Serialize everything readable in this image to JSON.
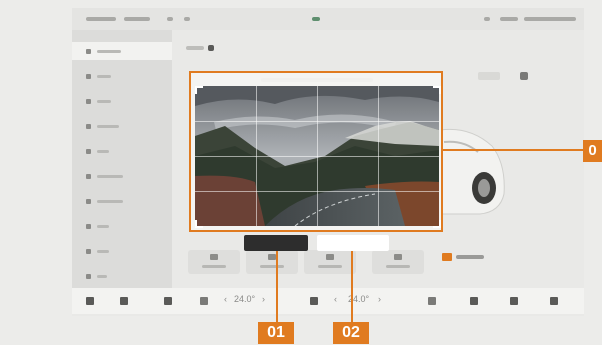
{
  "statusbar": {
    "items": [
      "",
      "",
      "",
      "",
      ""
    ]
  },
  "sidebar": {
    "items": [
      {
        "label": ""
      },
      {
        "label": ""
      },
      {
        "label": ""
      },
      {
        "label": ""
      },
      {
        "label": ""
      },
      {
        "label": ""
      },
      {
        "label": ""
      },
      {
        "label": ""
      },
      {
        "label": ""
      },
      {
        "label": ""
      }
    ]
  },
  "crop": {
    "title": ""
  },
  "buttons": {
    "cancel_label": "",
    "confirm_label": ""
  },
  "dock": {
    "temp_left": "24.0°",
    "temp_right": "24.0°"
  },
  "annotations": {
    "frame": "0",
    "cancel": "01",
    "confirm": "02"
  },
  "colors": {
    "callout": "#e07b20",
    "crop_frame": "#e07b20",
    "dark_button": "#2d2d2d"
  }
}
